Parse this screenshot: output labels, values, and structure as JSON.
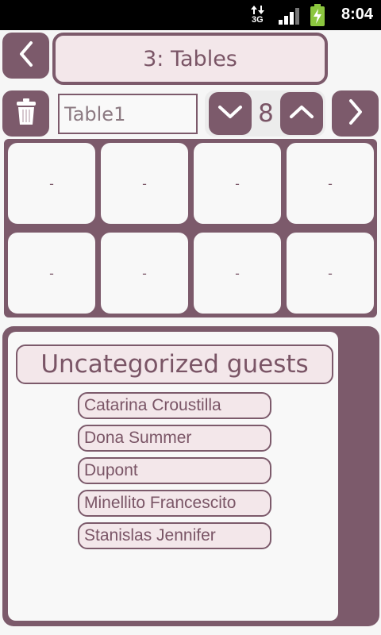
{
  "status_bar": {
    "network": "3G",
    "time": "8:04"
  },
  "header": {
    "title": "3: Tables"
  },
  "table_editor": {
    "name_value": "Table1",
    "seat_count": "8"
  },
  "seats": [
    "-",
    "-",
    "-",
    "-",
    "-",
    "-",
    "-",
    "-"
  ],
  "guests_panel": {
    "category": "Uncategorized guests",
    "guests": [
      "Catarina Croustilla",
      "Dona Summer",
      "Dupont",
      "Minellito Francescito",
      "Stanislas Jennifer"
    ]
  },
  "colors": {
    "accent": "#7c5a6b",
    "light_fill": "#f3e7ea",
    "background": "#f6f6f6"
  },
  "icons": [
    "back-icon",
    "trash-icon",
    "chevron-down-icon",
    "chevron-up-icon",
    "forward-icon"
  ]
}
